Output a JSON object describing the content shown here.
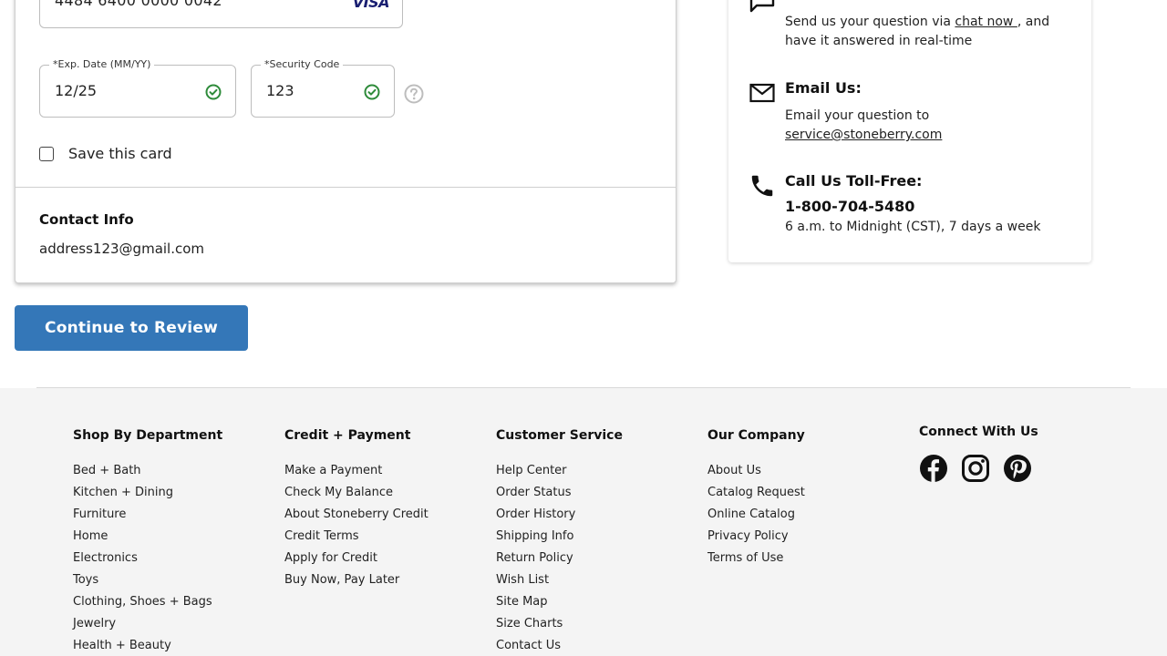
{
  "payment": {
    "card_number": "4484 6400 0000 0042",
    "card_brand": "VISA",
    "exp_label": "*Exp. Date (MM/YY)",
    "exp_value": "12/25",
    "sec_label": "*Security Code",
    "sec_value": "123",
    "save_label": "Save this card"
  },
  "contact": {
    "title": "Contact Info",
    "email": "address123@gmail.com"
  },
  "cta": {
    "label": "Continue to Review"
  },
  "help": {
    "chat_prefix": "Send us your question via ",
    "chat_link": "chat now ",
    "chat_suffix": ", and have it answered in real-time",
    "email_title": "Email Us:",
    "email_text": "Email your question to",
    "email_link": "service@stoneberry.com",
    "call_title": "Call Us Toll-Free:",
    "phone": "1-800-704-5480",
    "hours": "6 a.m. to Midnight (CST), 7 days a week"
  },
  "footer": {
    "col1": {
      "title": "Shop By Department",
      "items": [
        "Bed + Bath",
        "Kitchen + Dining",
        "Furniture",
        "Home",
        "Electronics",
        "Toys",
        "Clothing, Shoes + Bags",
        "Jewelry",
        "Health + Beauty"
      ]
    },
    "col2": {
      "title": "Credit + Payment",
      "items": [
        "Make a Payment",
        "Check My Balance",
        "About Stoneberry Credit",
        "Credit Terms",
        "Apply for Credit",
        "Buy Now, Pay Later"
      ]
    },
    "col3": {
      "title": "Customer Service",
      "items": [
        "Help Center",
        "Order Status",
        "Order History",
        "Shipping Info",
        "Return Policy",
        "Wish List",
        "Site Map",
        "Size Charts",
        "Contact Us"
      ]
    },
    "col4": {
      "title": "Our Company",
      "items": [
        "About Us",
        "Catalog Request",
        "Online Catalog",
        "Privacy Policy",
        "Terms of Use"
      ]
    },
    "social": {
      "title": "Connect With Us",
      "icons": [
        "facebook-icon",
        "instagram-icon",
        "pinterest-icon"
      ]
    }
  },
  "colors": {
    "accent": "#3477b8",
    "success": "#2e8b3a"
  }
}
